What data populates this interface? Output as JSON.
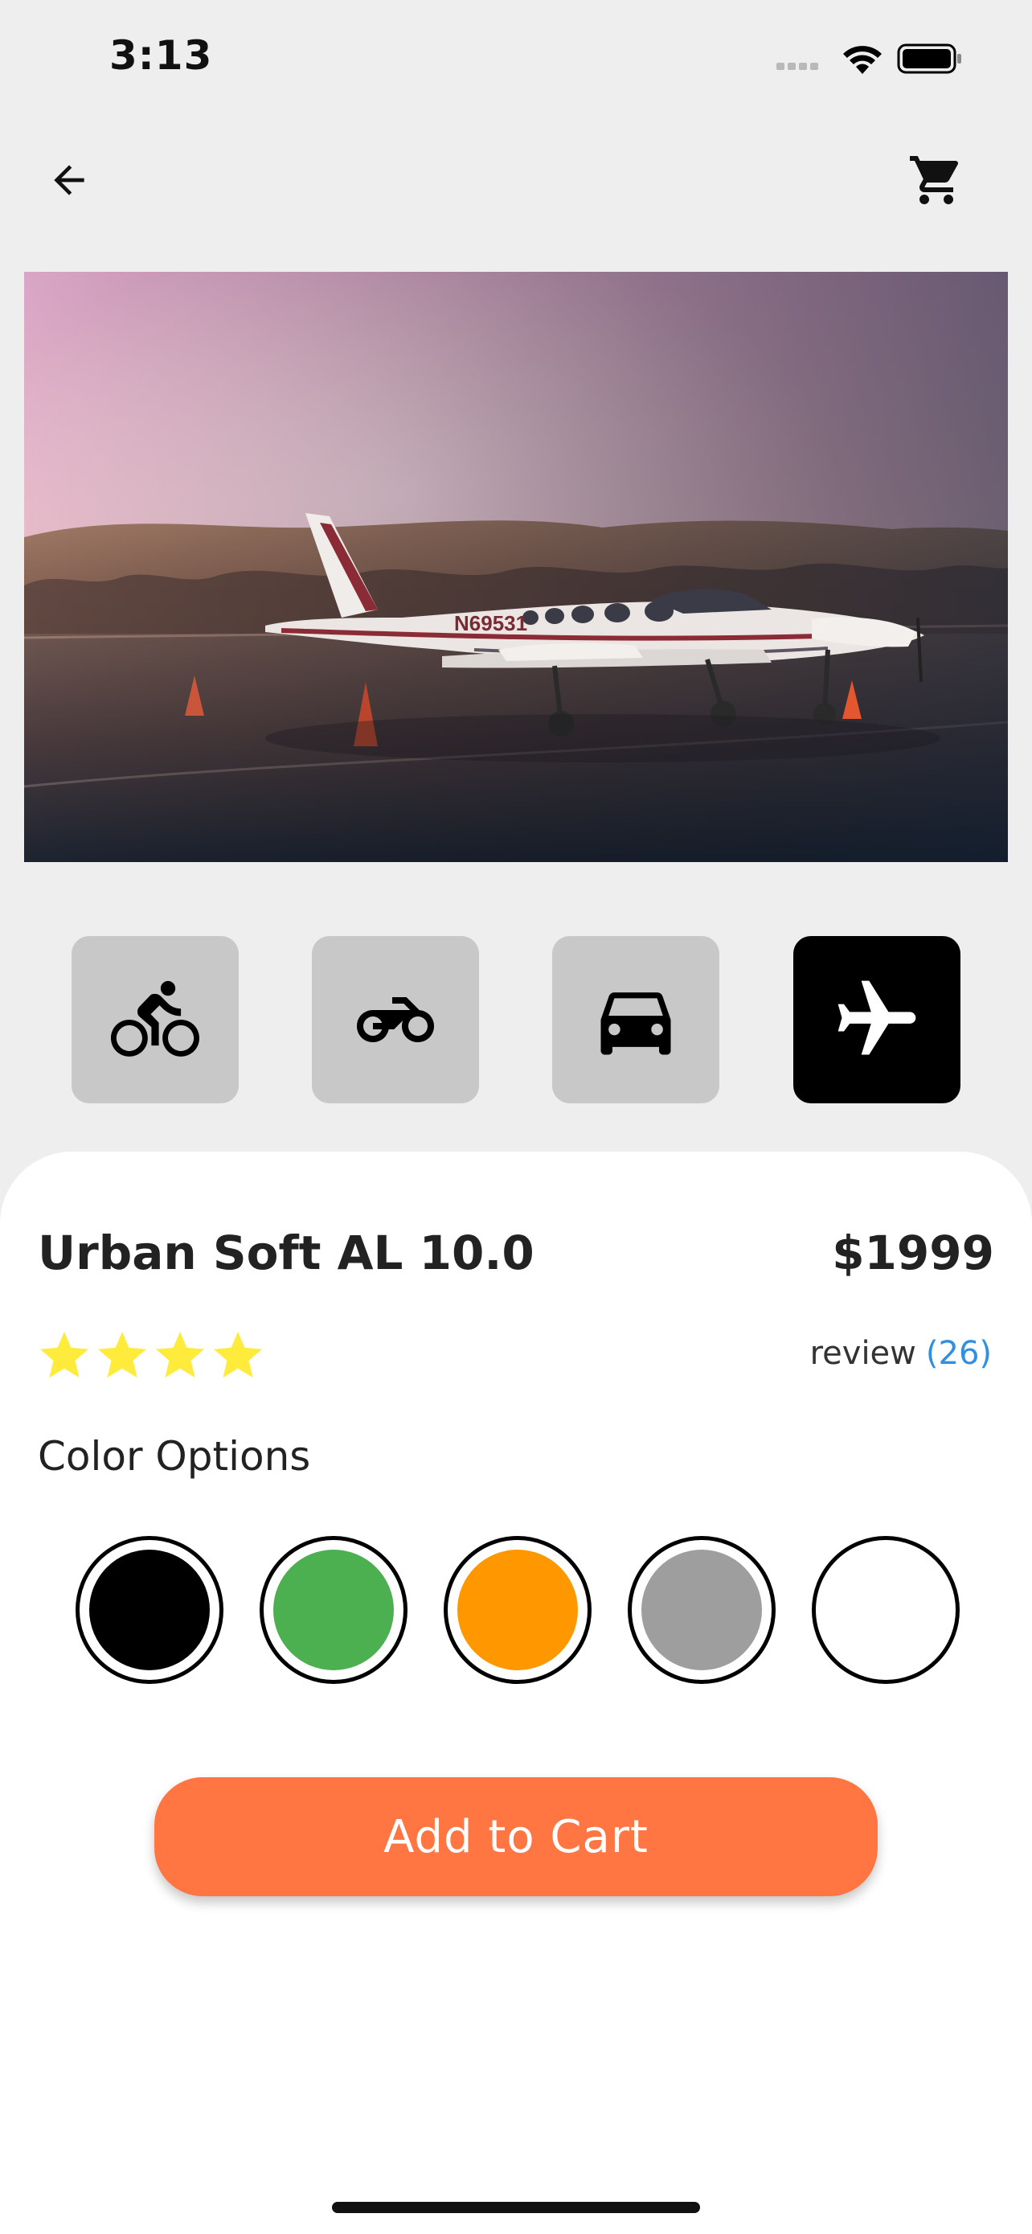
{
  "status_bar": {
    "time": "3:13"
  },
  "top_bar": {
    "back_icon": "arrow-left-icon",
    "cart_icon": "shopping-cart-icon"
  },
  "hero": {
    "tail_number": "N69531"
  },
  "categories": [
    {
      "icon": "bicycle-icon",
      "active": false
    },
    {
      "icon": "motorcycle-icon",
      "active": false
    },
    {
      "icon": "car-icon",
      "active": false
    },
    {
      "icon": "airplane-icon",
      "active": true
    }
  ],
  "product": {
    "name": "Urban Soft AL 10.0",
    "price": "$1999",
    "rating": 4,
    "review_label": "review",
    "review_count": "(26)"
  },
  "colors": {
    "title": "Color Options",
    "options": [
      "#000000",
      "#4caf50",
      "#ff9800",
      "#9e9e9e",
      "#ffffff"
    ]
  },
  "cta": {
    "label": "Add to Cart",
    "color": "#ff7642"
  },
  "theme": {
    "background": "#eeeeee",
    "star_color": "#ffeb3b",
    "link_color": "#2f8fe0"
  }
}
